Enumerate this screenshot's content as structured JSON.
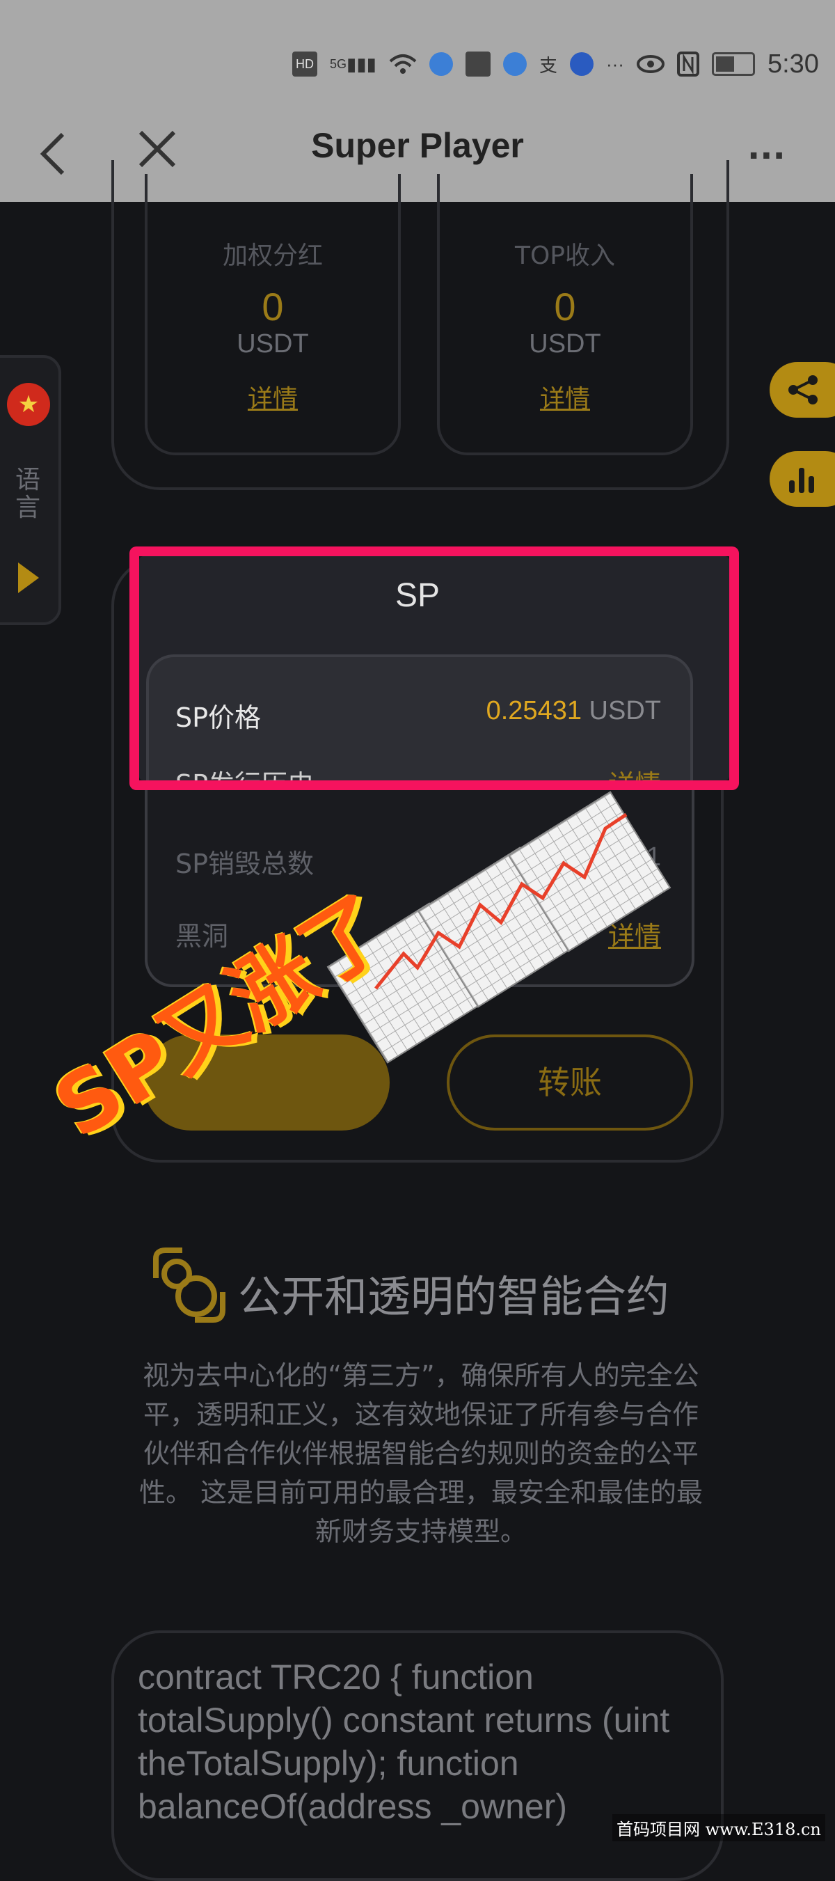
{
  "status_bar": {
    "time": "5:30",
    "icons": [
      "hd-icon",
      "signal-icon",
      "wifi-icon",
      "app-icon",
      "sina-icon",
      "app-icon",
      "alipay-icon",
      "app-icon",
      "more-dots",
      "eye-icon",
      "nfc-icon",
      "battery-icon"
    ],
    "hd": "HD",
    "net": "5G",
    "alipay": "支",
    "more": "···"
  },
  "nav": {
    "back": "‹",
    "close": "✕",
    "title": "Super Player",
    "menu": "···"
  },
  "stats": [
    {
      "label": "加权分红",
      "value": "0",
      "unit": "USDT",
      "link": "详情"
    },
    {
      "label": "TOP收入",
      "value": "0",
      "unit": "USDT",
      "link": "详情"
    }
  ],
  "side": {
    "flag_star": "★",
    "language": "语言"
  },
  "sp": {
    "title": "SP",
    "rows": [
      {
        "label": "SP价格",
        "value": "0.25431",
        "unit": "USDT"
      },
      {
        "label": "SP发行历史",
        "link": "详情"
      },
      {
        "label": "SP销毁总数",
        "value": "3...01"
      },
      {
        "label": "黑洞",
        "link": "详情"
      }
    ],
    "transfer_button": "转账"
  },
  "sticker": {
    "text": "SP又涨了"
  },
  "contract_section": {
    "title": "公开和透明的智能合约",
    "body": "视为去中心化的“第三方”，确保所有人的完全公平，透明和正义，这有效地保证了所有参与合作伙伴和合作伙伴根据智能合约规则的资金的公平性。 这是目前可用的最合理，最安全和最佳的最新财务支持模型。",
    "code": "contract TRC20 { function totalSupply() constant returns (uint theTotalSupply); function balanceOf(address _owner)"
  },
  "watermark": "首码项目网 www.E318.cn",
  "colors": {
    "accent_gold": "#b38b13",
    "price_gold": "#e0a820",
    "highlight_pink": "#f5135e",
    "background": "#141518",
    "header_gray": "#a9a9a9"
  }
}
